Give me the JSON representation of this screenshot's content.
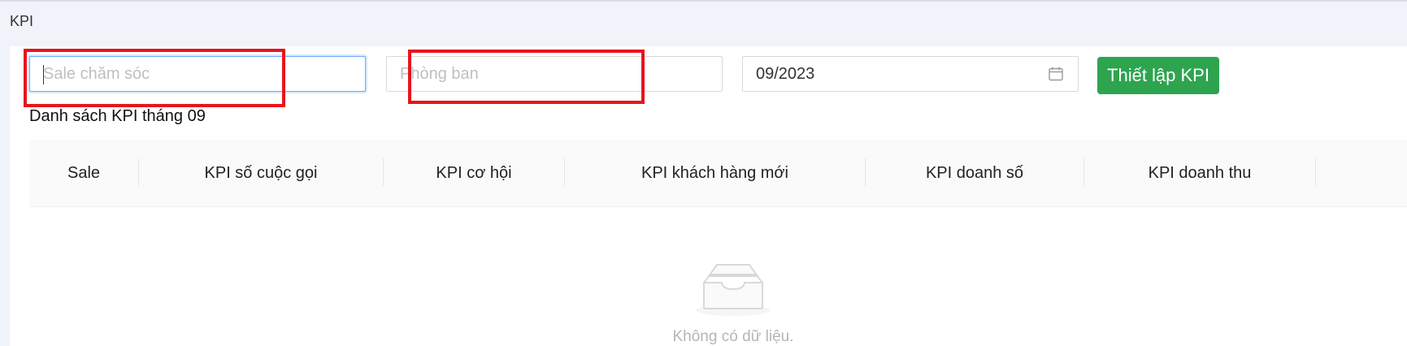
{
  "page": {
    "title": "KPI"
  },
  "filters": {
    "sale_placeholder": "Sale chăm sóc",
    "department_placeholder": "Phòng ban",
    "month_value": "09/2023",
    "setup_button": "Thiết lập KPI"
  },
  "table": {
    "title": "Danh sách KPI tháng 09",
    "columns": [
      "Sale",
      "KPI số cuộc gọi",
      "KPI cơ hội",
      "KPI khách hàng mới",
      "KPI doanh số",
      "KPI doanh thu"
    ],
    "empty_text": "Không có dữ liệu."
  },
  "colors": {
    "accent_button": "#2ea44f",
    "focus_border": "#6fa8f3",
    "annotation": "#e8141c"
  }
}
